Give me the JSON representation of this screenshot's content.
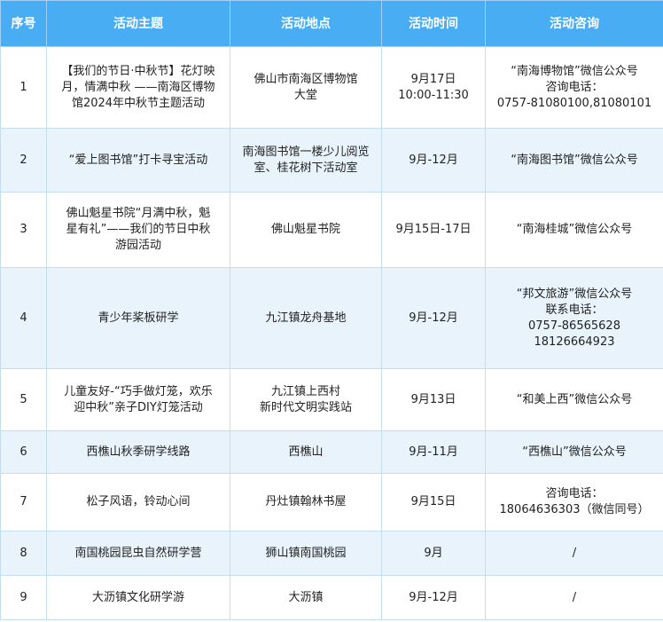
{
  "headers": [
    "序号",
    "活动主题",
    "活动地点",
    "活动时间",
    "活动咨询"
  ],
  "rows": [
    {
      "no": "1",
      "theme": [
        "【我们的节日·中秋节】花灯映",
        "月，情满中秋 ——南海区博物",
        "馆2024年中秋节主题活动"
      ],
      "place": [
        "佛山市南海区博物馆",
        "大堂"
      ],
      "time": [
        "9月17日",
        "10:00-11:30"
      ],
      "consult": [
        "“南海博物馆”微信公众号",
        "咨询电话：",
        "0757-81080100,81080101"
      ]
    },
    {
      "no": "2",
      "theme": [
        "“爱上图书馆”打卡寻宝活动"
      ],
      "place": [
        "南海图书馆一楼少儿阅览",
        "室、桂花树下活动室"
      ],
      "time": [
        "9月-12月"
      ],
      "consult": [
        "“南海图书馆”微信公众号"
      ]
    },
    {
      "no": "3",
      "theme": [
        "佛山魁星书院“月满中秋，魁",
        "星有礼”——我们的节日中秋",
        "游园活动"
      ],
      "place": [
        "佛山魁星书院"
      ],
      "time": [
        "9月15日-17日"
      ],
      "consult": [
        "“南海桂城”微信公众号"
      ]
    },
    {
      "no": "4",
      "theme": [
        "青少年桨板研学"
      ],
      "place": [
        "九江镇龙舟基地"
      ],
      "time": [
        "9月-12月"
      ],
      "consult": [
        "“邦文旅游”微信公众号",
        "联系电话：",
        "0757-86565628",
        "18126664923"
      ]
    },
    {
      "no": "5",
      "theme": [
        "儿童友好-“巧手做灯笼，欢乐",
        "迎中秋”亲子DIY灯笼活动"
      ],
      "place": [
        "九江镇上西村",
        "新时代文明实践站"
      ],
      "time": [
        "9月13日"
      ],
      "consult": [
        "“和美上西”微信公众号"
      ]
    },
    {
      "no": "6",
      "theme": [
        "西樵山秋季研学线路"
      ],
      "place": [
        "西樵山"
      ],
      "time": [
        "9月-11月"
      ],
      "consult": [
        "“西樵山”微信公众号"
      ]
    },
    {
      "no": "7",
      "theme": [
        "松子风语，铃动心间"
      ],
      "place": [
        "丹灶镇翰林书屋"
      ],
      "time": [
        "9月15日"
      ],
      "consult": [
        "咨询电话：",
        "18064636303（微信同号）"
      ]
    },
    {
      "no": "8",
      "theme": [
        "南国桃园昆虫自然研学营"
      ],
      "place": [
        "狮山镇南国桃园"
      ],
      "time": [
        "9月"
      ],
      "consult": [
        "/"
      ]
    },
    {
      "no": "9",
      "theme": [
        "大沥镇文化研学游"
      ],
      "place": [
        "大沥镇"
      ],
      "time": [
        "9月-12月"
      ],
      "consult": [
        "/"
      ]
    }
  ],
  "colors": {
    "header_bg": "#49adf3",
    "header_text": "#ffffff",
    "alt_row_bg": "#e8f3fc",
    "border": "#c6dcef"
  }
}
